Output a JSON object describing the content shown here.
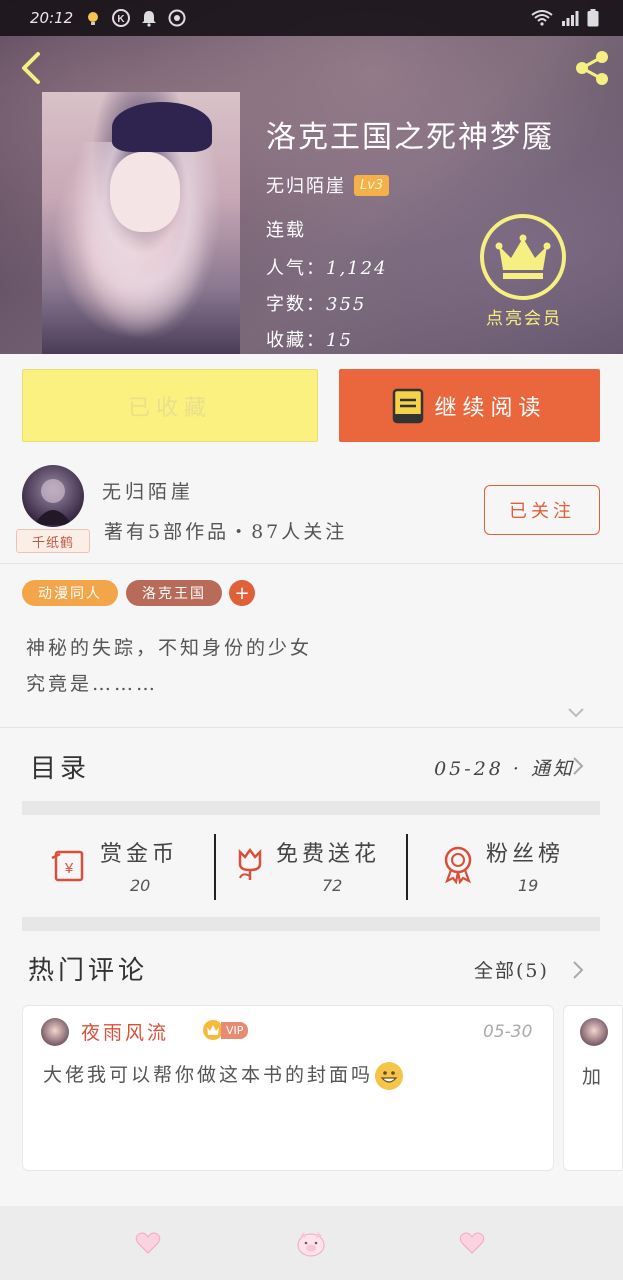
{
  "status_bar": {
    "time": "20:12"
  },
  "book": {
    "title": "洛克王国之死神梦魇",
    "author": "无归陌崖",
    "level": "Lv3",
    "status": "连载",
    "popularity_label": "人气：",
    "popularity_value": "1,124",
    "word_count_label": "字数：",
    "word_count_value": "355",
    "favorites_label": "收藏：",
    "favorites_value": "15"
  },
  "vip": {
    "label": "点亮会员"
  },
  "actions": {
    "collected_label": "已收藏",
    "continue_label": "继续阅读"
  },
  "author_card": {
    "name": "无归陌崖",
    "info": "著有5部作品・87人关注",
    "avatar_tag": "千纸鹤",
    "follow_label": "已关注"
  },
  "tags": [
    {
      "label": "动漫同人"
    },
    {
      "label": "洛克王国"
    }
  ],
  "tag_add_label": "+",
  "synopsis": "神秘的失踪，不知身份的少女\n究竟是………",
  "catalog": {
    "title": "目录",
    "update": "05-28 · 通知"
  },
  "stats": [
    {
      "label": "赏金币",
      "value": "20",
      "icon": "reward-coin-icon"
    },
    {
      "label": "免费送花",
      "value": "72",
      "icon": "flower-icon"
    },
    {
      "label": "粉丝榜",
      "value": "19",
      "icon": "medal-icon"
    }
  ],
  "comments": {
    "title": "热门评论",
    "all_label": "全部(5)",
    "items": [
      {
        "user": "夜雨风流",
        "badge": "VIP",
        "date": "05-30",
        "text": "大佬我可以帮你做这本书的封面吗"
      }
    ],
    "peek_text": "加"
  },
  "colors": {
    "accent_orange": "#ea663d",
    "collected_yellow": "#fbf181",
    "vip_yellow": "#f6ef82",
    "tag_orange": "#f3a54a",
    "tag_brown": "#b76b58"
  }
}
